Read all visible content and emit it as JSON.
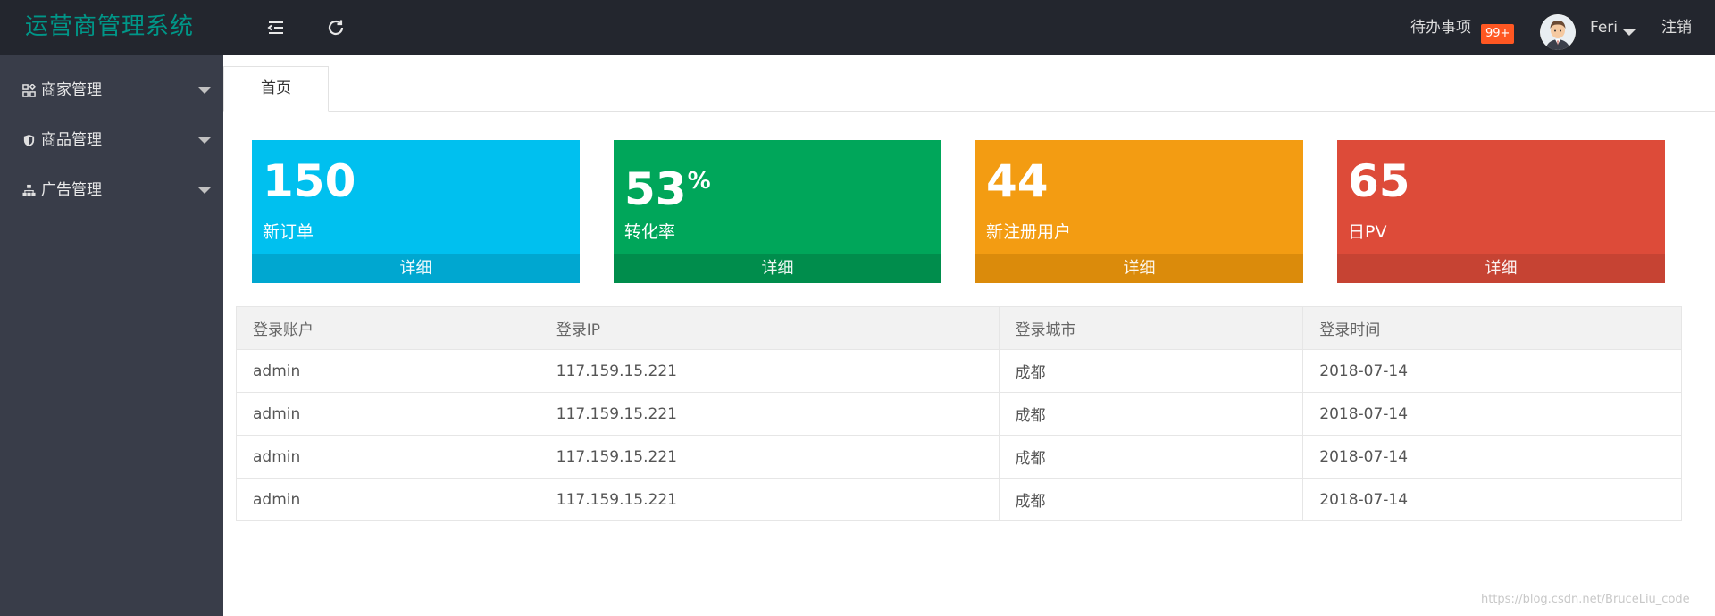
{
  "header": {
    "app_title": "运营商管理系统",
    "todo_label": "待办事项",
    "todo_badge": "99+",
    "user_name": "Feri",
    "logout_label": "注销"
  },
  "sidebar": {
    "items": [
      {
        "label": "商家管理",
        "icon": "apps-icon"
      },
      {
        "label": "商品管理",
        "icon": "shield-icon"
      },
      {
        "label": "广告管理",
        "icon": "sitemap-icon"
      }
    ]
  },
  "tabs": [
    {
      "label": "首页",
      "active": true
    }
  ],
  "stats": [
    {
      "value": "150",
      "suffix": "",
      "label": "新订单",
      "footer": "详细",
      "color": "#00c0ef"
    },
    {
      "value": "53",
      "suffix": "%",
      "label": "转化率",
      "footer": "详细",
      "color": "#00a65a"
    },
    {
      "value": "44",
      "suffix": "",
      "label": "新注册用户",
      "footer": "详细",
      "color": "#f39c12"
    },
    {
      "value": "65",
      "suffix": "",
      "label": "日PV",
      "footer": "详细",
      "color": "#dd4b39"
    }
  ],
  "login_table": {
    "columns": [
      "登录账户",
      "登录IP",
      "登录城市",
      "登录时间"
    ],
    "rows": [
      [
        "admin",
        "117.159.15.221",
        "成都",
        "2018-07-14"
      ],
      [
        "admin",
        "117.159.15.221",
        "成都",
        "2018-07-14"
      ],
      [
        "admin",
        "117.159.15.221",
        "成都",
        "2018-07-14"
      ],
      [
        "admin",
        "117.159.15.221",
        "成都",
        "2018-07-14"
      ]
    ]
  },
  "watermark": "https://blog.csdn.net/BruceLiu_code",
  "colors": {
    "header_bg": "#23262e",
    "sidebar_bg": "#393d49",
    "logo": "#009688",
    "badge": "#ff5722"
  }
}
